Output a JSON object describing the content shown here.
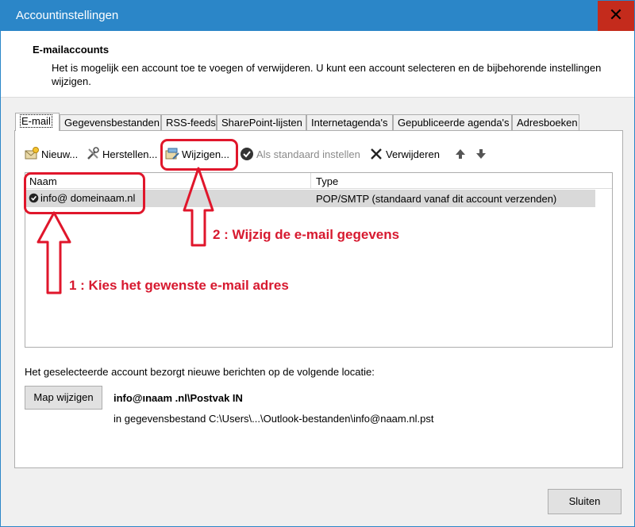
{
  "window": {
    "title": "Accountinstellingen",
    "close_glyph": "✕"
  },
  "header": {
    "title": "E-mailaccounts",
    "description": "Het is mogelijk een account toe te voegen of verwijderen. U kunt een account selecteren en de bijbehorende instellingen wijzigen."
  },
  "tabs": [
    {
      "label": "E-mail",
      "active": true
    },
    {
      "label": "Gegevensbestanden"
    },
    {
      "label": "RSS-feeds"
    },
    {
      "label": "SharePoint-lijsten"
    },
    {
      "label": "Internetagenda's"
    },
    {
      "label": "Gepubliceerde agenda's"
    },
    {
      "label": "Adresboeken"
    }
  ],
  "toolbar": {
    "new_label": "Nieuw...",
    "repair_label": "Herstellen...",
    "change_label": "Wijzigen...",
    "default_label": "Als standaard instellen",
    "remove_label": "Verwijderen"
  },
  "list": {
    "columns": [
      "Naam",
      "Type"
    ],
    "rows": [
      {
        "name": "info@ domeinaam.nl",
        "type": "POP/SMTP (standaard vanaf dit account verzenden)"
      }
    ]
  },
  "location": {
    "label": "Het geselecteerde account bezorgt nieuwe berichten op de volgende locatie:",
    "button": "Map wijzigen",
    "path": "info@ınaam .nl\\Postvak IN",
    "file": "in gegevensbestand C:\\Users\\...\\Outlook-bestanden\\info@naam.nl.pst"
  },
  "footer": {
    "close_button": "Sluiten"
  },
  "annotations": {
    "step1": "1 : Kies het gewenste e-mail adres",
    "step2": "2 : Wijzig de e-mail gegevens"
  },
  "colors": {
    "titlebar": "#2b86c8",
    "close": "#c42b1c",
    "annotation": "#e0162b"
  }
}
